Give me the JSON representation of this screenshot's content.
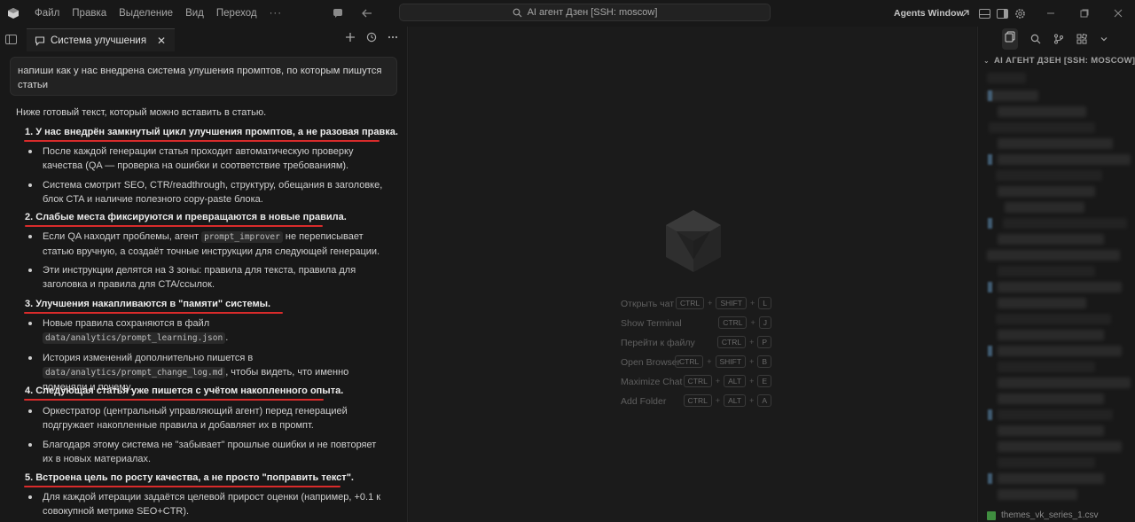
{
  "titlebar": {
    "menu": [
      "Файл",
      "Правка",
      "Выделение",
      "Вид",
      "Переход"
    ],
    "more": "···",
    "search_text": "AI агент Дзен [SSH: moscow]",
    "agents_window": "Agents Window"
  },
  "chat": {
    "tab_title": "Система улучшения ...",
    "user_message": "напиши как у нас внедрена система улушения промптов, по которым пишутся статьи",
    "intro": "Ниже готовый текст, который можно вставить в статью.",
    "items": [
      {
        "heading": "1. У нас внедрён замкнутый цикл улучшения промптов, а не разовая правка.",
        "bullets": [
          "После каждой генерации статья проходит автоматическую проверку качества (QA — проверка на ошибки и соответствие требованиям).",
          "Система смотрит SEO, CTR/readthrough, структуру, обещания в заголовке, блок CTA и наличие полезного copy-paste блока."
        ]
      },
      {
        "heading": "2. Слабые места фиксируются и превращаются в новые правила.",
        "bullets": [
          "Если QA находит проблемы, агент prompt_improver не переписывает статью вручную, а создаёт точные инструкции для следующей генерации.",
          "Эти инструкции делятся на 3 зоны: правила для текста, правила для заголовка и правила для CTA/ссылок."
        ]
      },
      {
        "heading": "3. Улучшения накапливаются в \"памяти\" системы.",
        "bullets": [
          "Новые правила сохраняются в файл data/analytics/prompt_learning.json.",
          "История изменений дополнительно пишется в data/analytics/prompt_change_log.md, чтобы видеть, что именно поменяли и почему."
        ]
      },
      {
        "heading": "4. Следующая статья уже пишется с учётом накопленного опыта.",
        "bullets": [
          "Оркестратор (центральный управляющий агент) перед генерацией подгружает накопленные правила и добавляет их в промпт.",
          "Благодаря этому система не \"забывает\" прошлые ошибки и не повторяет их в новых материалах."
        ]
      },
      {
        "heading": "5. Встроена цель по росту качества, а не просто \"поправить текст\".",
        "bullets": [
          "Для каждой итерации задаётся целевой прирост оценки (например, +0.1 к совокупной метрике SEO+CTR)."
        ]
      }
    ],
    "code_snippets": {
      "agent": "prompt_improver",
      "learning_file": "data/analytics/prompt_learning.json",
      "change_log": "data/analytics/prompt_change_log.md"
    }
  },
  "shortcuts": [
    {
      "label": "Открыть чат",
      "keys": [
        "CTRL",
        "SHIFT",
        "L"
      ]
    },
    {
      "label": "Show Terminal",
      "keys": [
        "CTRL",
        "J"
      ]
    },
    {
      "label": "Перейти к файлу",
      "keys": [
        "CTRL",
        "P"
      ]
    },
    {
      "label": "Open Browser",
      "keys": [
        "CTRL",
        "SHIFT",
        "B"
      ]
    },
    {
      "label": "Maximize Chat",
      "keys": [
        "CTRL",
        "ALT",
        "E"
      ]
    },
    {
      "label": "Add Folder",
      "keys": [
        "CTRL",
        "ALT",
        "A"
      ]
    }
  ],
  "explorer": {
    "header": "AI АГЕНТ ДЗЕН [SSH: MOSCOW]",
    "last_file": "themes_vk_series_1.csv"
  },
  "colors": {
    "accent_underline": "#d92b2b",
    "background": "#181818"
  }
}
